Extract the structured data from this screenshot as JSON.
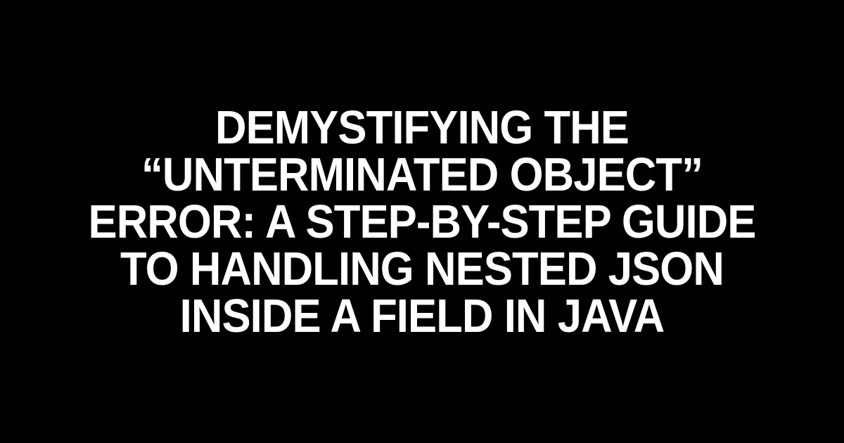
{
  "title": "Demystifying the “Unterminated Object” Error: A Step-by-Step Guide to Handling Nested JSON Inside a Field in Java"
}
